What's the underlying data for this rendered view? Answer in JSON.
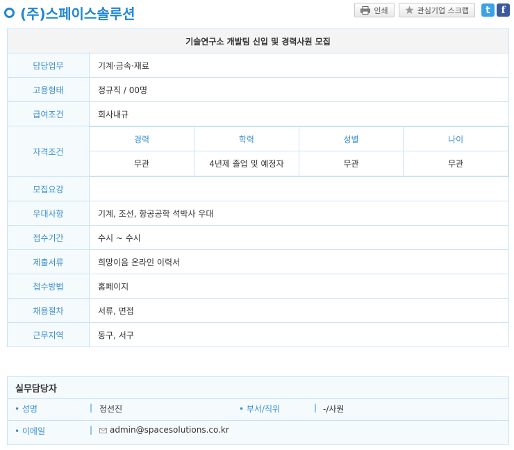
{
  "header": {
    "company_name": "(주)스페이스솔루션",
    "print_label": "인쇄",
    "scrap_label": "관심기업 스크랩",
    "twitter_glyph": "t",
    "facebook_glyph": "f"
  },
  "job": {
    "title": "기술연구소 개발팀 신입 및 경력사원 모집",
    "rows": [
      {
        "label": "담당업무",
        "value": "기계·금속·재료"
      },
      {
        "label": "고용형태",
        "value": "정규직 / 00명"
      },
      {
        "label": "급여조건",
        "value": "회사내규"
      }
    ],
    "qualification": {
      "label": "자격조건",
      "headers": [
        "경력",
        "학력",
        "성별",
        "나이"
      ],
      "values": [
        "무관",
        "4년제 졸업 및 예정자",
        "무관",
        "무관"
      ]
    },
    "rows2": [
      {
        "label": "모집요강",
        "value": ""
      },
      {
        "label": "우대사항",
        "value": "기계, 조선, 항공공학 석박사 우대"
      },
      {
        "label": "접수기간",
        "value": "수시 ~ 수시"
      },
      {
        "label": "제출서류",
        "value": "희망이음 온라인 이력서"
      },
      {
        "label": "접수방법",
        "value": "홈페이지"
      },
      {
        "label": "채용절차",
        "value": "서류, 면접"
      },
      {
        "label": "근무지역",
        "value": "동구, 서구"
      }
    ]
  },
  "contact": {
    "title": "실무담당자",
    "name_label": "• 성명",
    "name_value": "정선진",
    "dept_label": "• 부서/직위",
    "dept_value": "-/사원",
    "email_label": "• 이메일",
    "email_value": "admin@spacesolutions.co.kr",
    "separator": "|"
  },
  "colors": {
    "accent": "#1f86d1",
    "label": "#3a8fd0",
    "border": "#c9e3f5"
  }
}
